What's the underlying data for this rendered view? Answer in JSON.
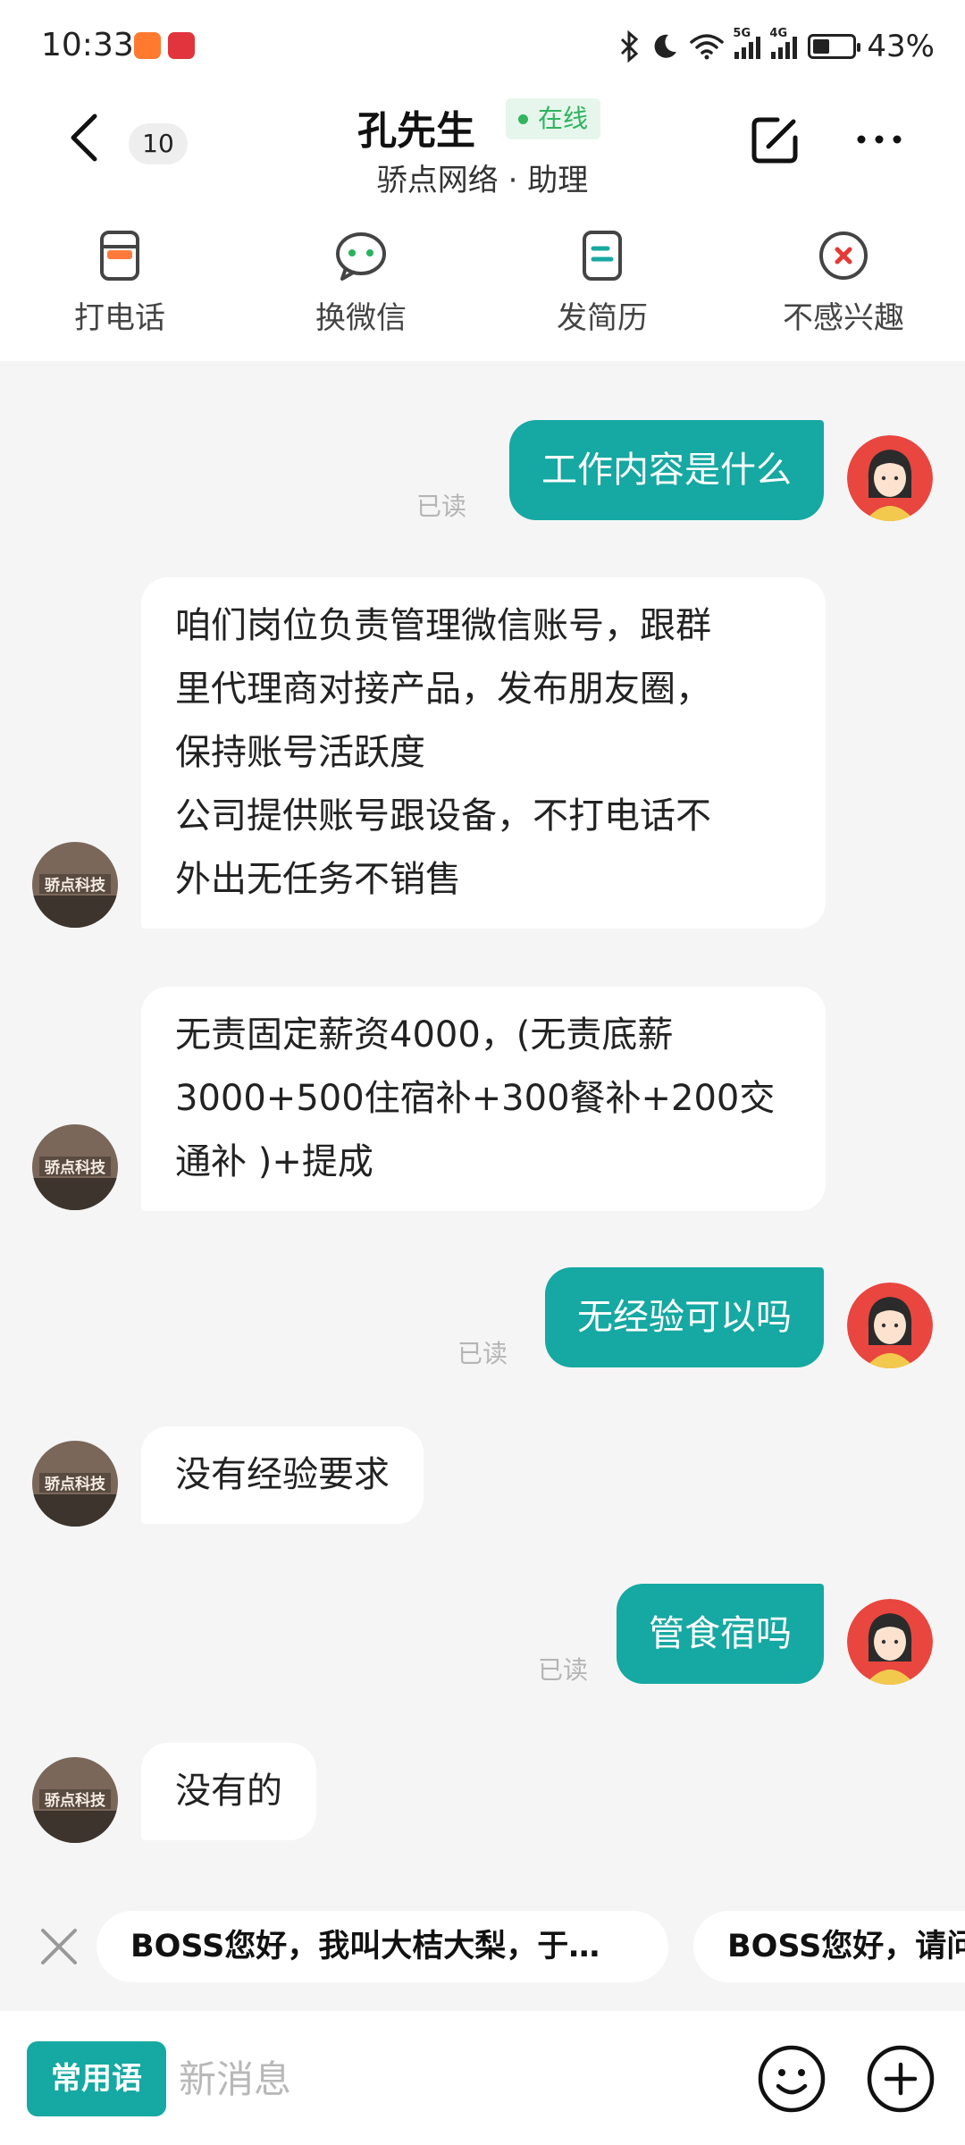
{
  "status": {
    "time": "10:33",
    "network1": "5G",
    "network2": "4G",
    "battery": "43%",
    "battery_level": 0.43
  },
  "header": {
    "unread_count": "10",
    "name": "孔先生",
    "online": "在线",
    "company": "骄点网络 · 助理"
  },
  "actions": [
    {
      "label": "打电话",
      "icon": "phone-icon"
    },
    {
      "label": "换微信",
      "icon": "wechat-icon"
    },
    {
      "label": "发简历",
      "icon": "resume-icon"
    },
    {
      "label": "不感兴趣",
      "icon": "not-interested-icon"
    }
  ],
  "messages": {
    "m1": {
      "text": "工作内容是什么",
      "status": "已读"
    },
    "m2": {
      "line1": "咱们岗位负责管理微信账号，跟群",
      "line2": "里代理商对接产品，发布朋友圈，",
      "line3": "保持账号活跃度",
      "line4": "公司提供账号跟设备，不打电话不",
      "line5": "外出无任务不销售"
    },
    "m3": {
      "line1": "无责固定薪资4000，(无责底薪",
      "line2": "3000+500住宿补+300餐补+200交",
      "line3": "通补 )+提成"
    },
    "m4": {
      "text": "无经验可以吗",
      "status": "已读"
    },
    "m5": {
      "text": "没有经验要求"
    },
    "m6": {
      "text": "管食宿吗",
      "status": "已读"
    },
    "m7": {
      "text": "没有的"
    }
  },
  "quick_replies": [
    "BOSS您好，我叫大桔大梨，于…",
    "BOSS您好，请问"
  ],
  "input": {
    "phrases_label": "常用语",
    "placeholder": "新消息"
  },
  "colors": {
    "accent": "#16a8a2",
    "online": "#32b35f",
    "background": "#f5f5f5"
  }
}
